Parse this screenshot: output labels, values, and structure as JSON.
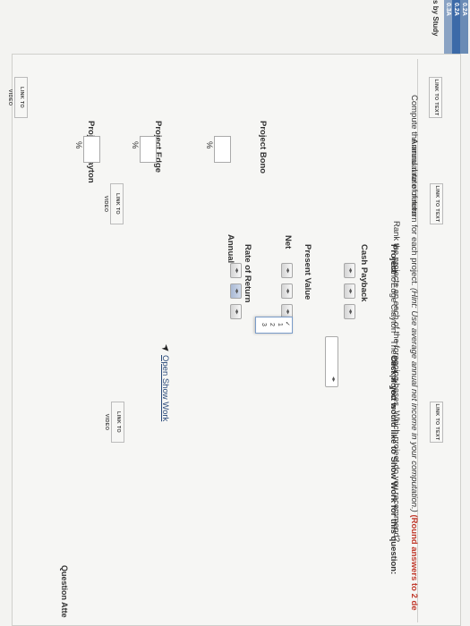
{
  "sidebar": {
    "tabs": [
      "0.2A",
      "0.2A",
      "0.3A"
    ],
    "study_label": "s by Study"
  },
  "top_links": {
    "text": "LINK TO TEXT",
    "video": "LINK TO VIDEO"
  },
  "section1": {
    "instruction": "Compute the annual rate of return for each project. ",
    "hint": "(Hint: Use average annual net income in your computation.) ",
    "round": "(Round answers to 2 de",
    "headers": [
      "Project Bono",
      "Project Edge",
      "Project Clayton"
    ],
    "row_label": "Annual rate of return",
    "percent": "%",
    "link_text": "LINK TO TEXT",
    "link_video": "LINK TO VIDEO"
  },
  "section2": {
    "instruction": "Rank the projects on each of the foregoing bases. Which project do you recommend?",
    "col_project": "Project",
    "col_payback": "Cash Payback",
    "col_npv_1": "Net",
    "col_npv_2": "Present Value",
    "col_arr_1": "Annual",
    "col_arr_2": "Rate of Return",
    "rows": [
      "Bono",
      "Edge",
      "Clayton"
    ],
    "options": [
      "✓",
      "1",
      "2",
      "3"
    ],
    "best_label": "The best project is",
    "show_work_prefix": "Click if you would like to Show Work for this question:",
    "show_work_link": "Open Show Work",
    "link_text": "LINK TO TEXT",
    "link_video": "LINK TO VIDEO"
  },
  "footer": {
    "attempts": "Question Atte"
  }
}
